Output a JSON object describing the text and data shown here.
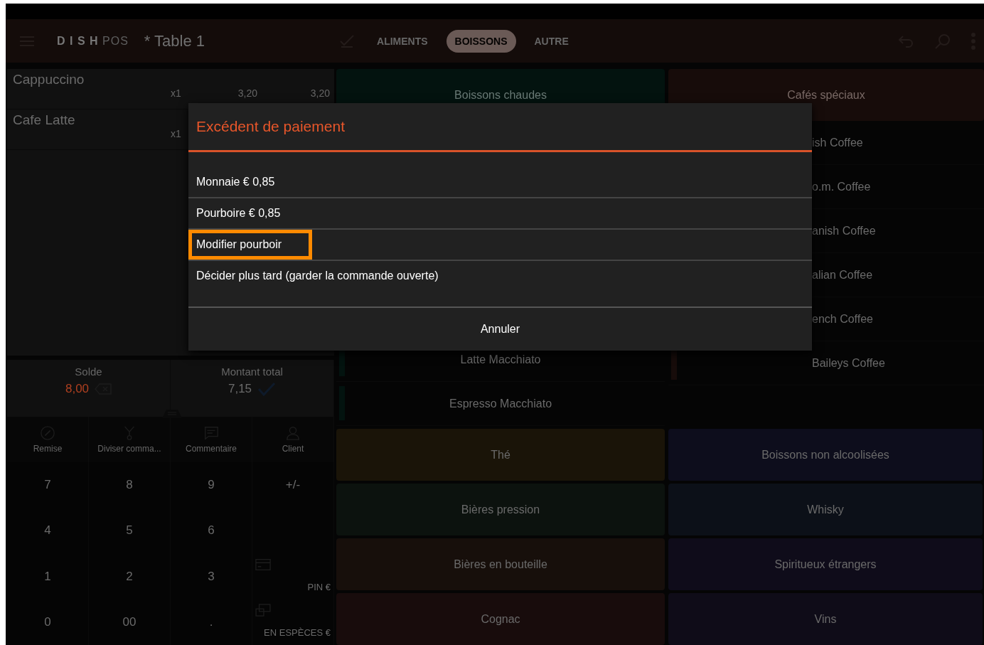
{
  "top_bar": {
    "logo_bold": "D I S H",
    "logo_light": "POS",
    "table_title": "* Table 1",
    "tabs": [
      {
        "label": "ALIMENTS",
        "selected": false
      },
      {
        "label": "BOISSONS",
        "selected": true
      },
      {
        "label": "AUTRE",
        "selected": false
      }
    ]
  },
  "order": {
    "rows": [
      {
        "name": "Cappuccino",
        "qty": "x1",
        "price": "3,20",
        "total": "3,20"
      },
      {
        "name": "Cafe Latte",
        "qty": "x1"
      }
    ]
  },
  "totals": [
    {
      "label": "Solde",
      "value": "8,00",
      "kind": "balance"
    },
    {
      "label": "Montant total",
      "value": "7,15",
      "kind": "total"
    }
  ],
  "actions": [
    {
      "label": "Remise"
    },
    {
      "label": "Diviser comma..."
    },
    {
      "label": "Commentaire"
    },
    {
      "label": "Client"
    }
  ],
  "keypad": [
    {
      "kind": "key",
      "label": "7"
    },
    {
      "kind": "key",
      "label": "8"
    },
    {
      "kind": "key",
      "label": "9"
    },
    {
      "kind": "key",
      "label": "+/-"
    },
    {
      "kind": "key",
      "label": "4"
    },
    {
      "kind": "key",
      "label": "5"
    },
    {
      "kind": "key",
      "label": "6"
    },
    {
      "kind": "empty"
    },
    {
      "kind": "key",
      "label": "1"
    },
    {
      "kind": "key",
      "label": "2"
    },
    {
      "kind": "key",
      "label": "3"
    },
    {
      "kind": "card",
      "label": "PIN €"
    },
    {
      "kind": "key",
      "label": "0"
    },
    {
      "kind": "key",
      "label": "00"
    },
    {
      "kind": "key",
      "label": "."
    },
    {
      "kind": "cash",
      "label": "EN ESPÈCES €"
    }
  ],
  "categories": [
    {
      "title": "Boissons chaudes",
      "color": "#03130f",
      "items": [
        "Latte Macchiato",
        "Espresso Macchiato"
      ]
    },
    {
      "title": "Cafés spéciaux",
      "color": "#170c0a",
      "items": [
        "ish Coffee",
        "o.m. Coffee",
        "anish Coffee",
        "alian Coffee",
        "ench Coffee",
        "Baileys Coffee"
      ]
    }
  ],
  "tiles": [
    {
      "label": "Thé",
      "color": "#1a1408"
    },
    {
      "label": "Boissons non alcoolisées",
      "color": "#0d0d1c"
    },
    {
      "label": "Bières pression",
      "color": "#0c120e"
    },
    {
      "label": "Whisky",
      "color": "#0c1018"
    },
    {
      "label": "Bières en bouteille",
      "color": "#170f0b"
    },
    {
      "label": "Spiritueux étrangers",
      "color": "#0f0c1a"
    },
    {
      "label": "Cognac",
      "color": "#180c0c"
    },
    {
      "label": "Vins",
      "color": "#0f0c18"
    }
  ],
  "dialog": {
    "title": "Excédent de paiement",
    "options": [
      {
        "label": "Monnaie € 0,85",
        "highlighted": false
      },
      {
        "label": "Pourboire € 0,85",
        "highlighted": false
      },
      {
        "label": "Modifier pourboir",
        "highlighted": true
      },
      {
        "label": "Décider plus tard (garder la commande ouverte)",
        "highlighted": false
      }
    ],
    "cancel": "Annuler"
  }
}
